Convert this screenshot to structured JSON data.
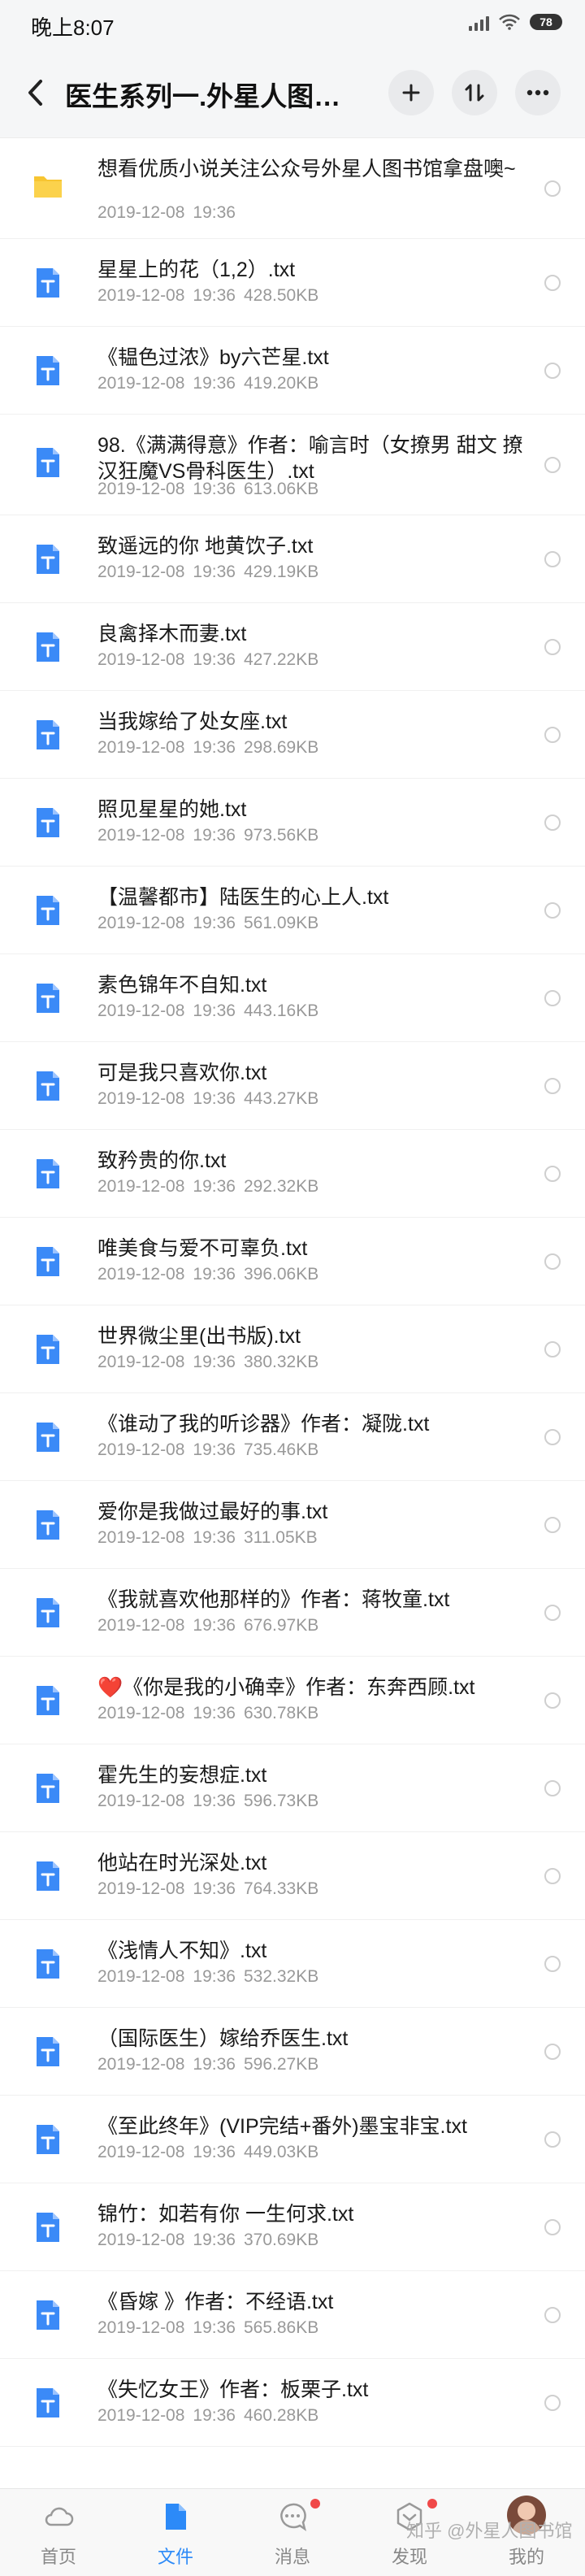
{
  "status_bar": {
    "time": "晚上8:07",
    "battery": "78"
  },
  "header": {
    "title": "医生系列一.外星人图书馆…"
  },
  "colors": {
    "accent": "#2c8af8",
    "folder": "#f7c531",
    "doc_icon": "#3b8af7",
    "badge": "#f04848"
  },
  "files": [
    {
      "type": "folder",
      "name": "想看优质小说关注公众号外星人图书馆拿盘噢~",
      "date": "2019-12-08",
      "time": "19:36",
      "size": ""
    },
    {
      "type": "txt",
      "name": "星星上的花（1,2）.txt",
      "date": "2019-12-08",
      "time": "19:36",
      "size": "428.50KB"
    },
    {
      "type": "txt",
      "name": "《韫色过浓》by六芒星.txt",
      "date": "2019-12-08",
      "time": "19:36",
      "size": "419.20KB"
    },
    {
      "type": "txt",
      "name": "98.《满满得意》作者：喻言时（女撩男 甜文 撩汉狂魔VS骨科医生）.txt",
      "date": "2019-12-08",
      "time": "19:36",
      "size": "613.06KB"
    },
    {
      "type": "txt",
      "name": "致遥远的你 地黄饮子.txt",
      "date": "2019-12-08",
      "time": "19:36",
      "size": "429.19KB"
    },
    {
      "type": "txt",
      "name": "良禽择木而妻.txt",
      "date": "2019-12-08",
      "time": "19:36",
      "size": "427.22KB"
    },
    {
      "type": "txt",
      "name": "当我嫁给了处女座.txt",
      "date": "2019-12-08",
      "time": "19:36",
      "size": "298.69KB"
    },
    {
      "type": "txt",
      "name": "照见星星的她.txt",
      "date": "2019-12-08",
      "time": "19:36",
      "size": "973.56KB"
    },
    {
      "type": "txt",
      "name": "【温馨都市】陆医生的心上人.txt",
      "date": "2019-12-08",
      "time": "19:36",
      "size": "561.09KB"
    },
    {
      "type": "txt",
      "name": "素色锦年不自知.txt",
      "date": "2019-12-08",
      "time": "19:36",
      "size": "443.16KB"
    },
    {
      "type": "txt",
      "name": "可是我只喜欢你.txt",
      "date": "2019-12-08",
      "time": "19:36",
      "size": "443.27KB"
    },
    {
      "type": "txt",
      "name": "致矜贵的你.txt",
      "date": "2019-12-08",
      "time": "19:36",
      "size": "292.32KB"
    },
    {
      "type": "txt",
      "name": "唯美食与爱不可辜负.txt",
      "date": "2019-12-08",
      "time": "19:36",
      "size": "396.06KB"
    },
    {
      "type": "txt",
      "name": "世界微尘里(出书版).txt",
      "date": "2019-12-08",
      "time": "19:36",
      "size": "380.32KB"
    },
    {
      "type": "txt",
      "name": "《谁动了我的听诊器》作者：凝陇.txt",
      "date": "2019-12-08",
      "time": "19:36",
      "size": "735.46KB"
    },
    {
      "type": "txt",
      "name": "爱你是我做过最好的事.txt",
      "date": "2019-12-08",
      "time": "19:36",
      "size": "311.05KB"
    },
    {
      "type": "txt",
      "name": "《我就喜欢他那样的》作者：蒋牧童.txt",
      "date": "2019-12-08",
      "time": "19:36",
      "size": "676.97KB"
    },
    {
      "type": "txt",
      "name": "❤️《你是我的小确幸》作者：东奔西顾.txt",
      "date": "2019-12-08",
      "time": "19:36",
      "size": "630.78KB"
    },
    {
      "type": "txt",
      "name": "霍先生的妄想症.txt",
      "date": "2019-12-08",
      "time": "19:36",
      "size": "596.73KB"
    },
    {
      "type": "txt",
      "name": "他站在时光深处.txt",
      "date": "2019-12-08",
      "time": "19:36",
      "size": "764.33KB"
    },
    {
      "type": "txt",
      "name": "《浅情人不知》.txt",
      "date": "2019-12-08",
      "time": "19:36",
      "size": "532.32KB"
    },
    {
      "type": "txt",
      "name": "（国际医生）嫁给乔医生.txt",
      "date": "2019-12-08",
      "time": "19:36",
      "size": "596.27KB"
    },
    {
      "type": "txt",
      "name": "《至此终年》(VIP完结+番外)墨宝非宝.txt",
      "date": "2019-12-08",
      "time": "19:36",
      "size": "449.03KB"
    },
    {
      "type": "txt",
      "name": "锦竹：如若有你 一生何求.txt",
      "date": "2019-12-08",
      "time": "19:36",
      "size": "370.69KB"
    },
    {
      "type": "txt",
      "name": "《昏嫁 》作者：不经语.txt",
      "date": "2019-12-08",
      "time": "19:36",
      "size": "565.86KB"
    },
    {
      "type": "txt",
      "name": "《失忆女王》作者：板栗子.txt",
      "date": "2019-12-08",
      "time": "19:36",
      "size": "460.28KB"
    }
  ],
  "bottom_nav": {
    "items": [
      {
        "label": "首页",
        "icon": "cloud-icon"
      },
      {
        "label": "文件",
        "icon": "file-icon",
        "active": true
      },
      {
        "label": "消息",
        "icon": "message-icon",
        "badge": true
      },
      {
        "label": "发现",
        "icon": "discover-icon",
        "badge": true
      },
      {
        "label": "我的",
        "icon": "avatar"
      }
    ]
  },
  "watermark": "知乎 @外星人图书馆"
}
